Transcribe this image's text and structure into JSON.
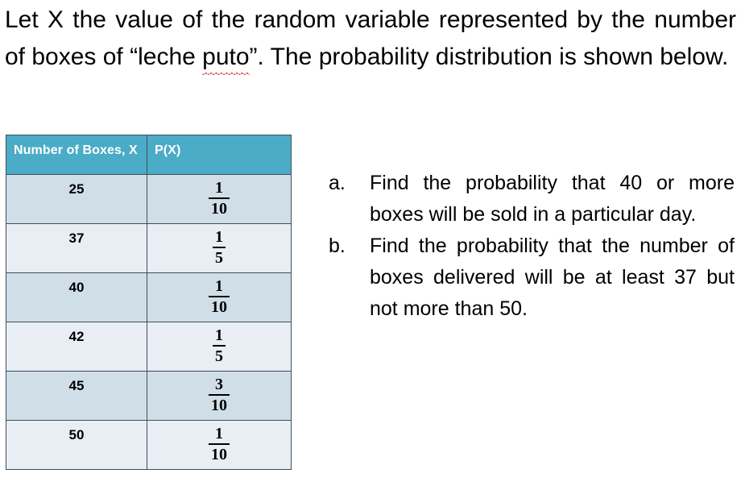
{
  "intro": {
    "before_misspelling": "Let X the value of the random variable represented by the number of boxes of “leche ",
    "misspelled_word": "puto",
    "after_misspelling": "”. The probability distribution is shown below.",
    "full_text": "Let X the value of the random variable represented by the number of boxes of “leche puto”. The probability distribution is shown below.",
    "spellcheck_underline_color": "#d94a4a"
  },
  "table": {
    "header_bg": "#4aacc6",
    "header_text_color": "#ffffff",
    "row_bg_odd": "#d0dfe7",
    "row_bg_even": "#e8eef4",
    "border_color": "#404f55",
    "columns": [
      "Number of Boxes, X",
      "P(X)"
    ],
    "rows": [
      {
        "x": "25",
        "p_numerator": "1",
        "p_denominator": "10"
      },
      {
        "x": "37",
        "p_numerator": "1",
        "p_denominator": "5"
      },
      {
        "x": "40",
        "p_numerator": "1",
        "p_denominator": "10"
      },
      {
        "x": "42",
        "p_numerator": "1",
        "p_denominator": "5"
      },
      {
        "x": "45",
        "p_numerator": "3",
        "p_denominator": "10"
      },
      {
        "x": "50",
        "p_numerator": "1",
        "p_denominator": "10"
      }
    ]
  },
  "questions": [
    {
      "marker": "a.",
      "text": "Find the probability that 40 or more boxes will be sold in a particular day."
    },
    {
      "marker": "b.",
      "text": "Find the probability that the number of boxes delivered will be at least 37 but not more than 50."
    }
  ]
}
